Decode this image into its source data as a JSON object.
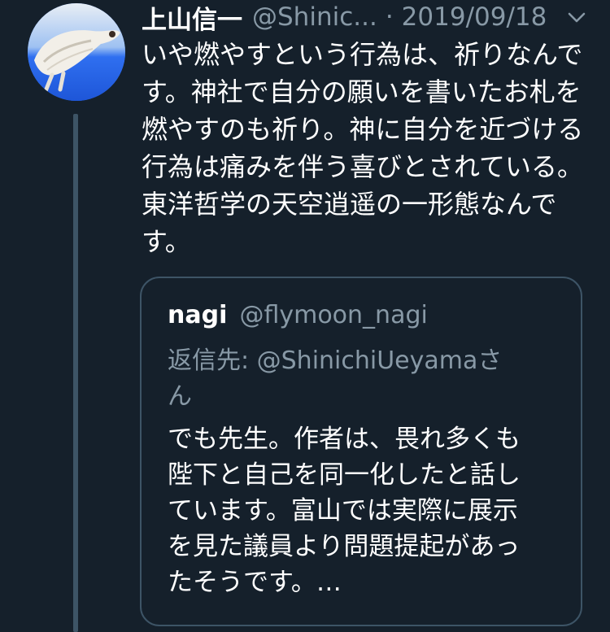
{
  "tweet": {
    "author_name": "上山信一",
    "author_handle": "@Shinic...",
    "separator": "·",
    "date": "2019/09/18",
    "text": "いや燃やすという行為は、祈りなんです。神社で自分の願いを書いたお札を燃やすのも祈り。神に自分を近づける行為は痛みを伴う喜びとされている。東洋哲学の天空逍遥の一形態なんです。"
  },
  "quoted_tweet": {
    "author_name": "nagi",
    "author_handle": "@flymoon_nagi",
    "reply_to": "返信先: @ShinichiUeyamaさん",
    "text": "でも先生。作者は、畏れ多くも陛下と自己を同一化したと話しています。富山では実際に展示を見た議員より問題提起があったそうです。…"
  },
  "colors": {
    "background": "#15202b",
    "secondary_text": "#8899a6",
    "border": "#3d5466"
  },
  "icons": {
    "avatar": "dog-avatar",
    "menu": "chevron-down-icon"
  }
}
